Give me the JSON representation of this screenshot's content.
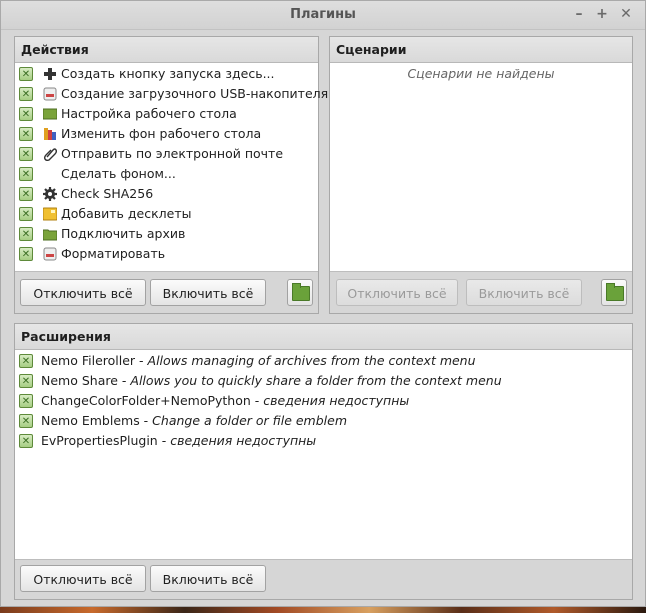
{
  "window": {
    "title": "Плагины"
  },
  "actions": {
    "header": "Действия",
    "items": [
      {
        "label": "Создать кнопку запуска здесь...",
        "icon": "plus-icon"
      },
      {
        "label": "Создание загрузочного USB-накопителя",
        "icon": "usb-drive-icon"
      },
      {
        "label": "Настройка рабочего стола",
        "icon": "desktop-settings-icon"
      },
      {
        "label": "Изменить фон рабочего стола",
        "icon": "wallpaper-icon"
      },
      {
        "label": "Отправить по электронной почте",
        "icon": "paperclip-icon"
      },
      {
        "label": "Сделать фоном...",
        "icon": ""
      },
      {
        "label": "Check SHA256",
        "icon": "gear-icon"
      },
      {
        "label": "Добавить десклеты",
        "icon": "desklet-icon"
      },
      {
        "label": "Подключить архив",
        "icon": "folder-icon"
      },
      {
        "label": "Форматировать",
        "icon": "usb-drive-icon"
      }
    ],
    "disable_all": "Отключить всё",
    "enable_all": "Включить всё"
  },
  "scripts": {
    "header": "Сценарии",
    "empty": "Сценарии не найдены",
    "disable_all": "Отключить всё",
    "enable_all": "Включить всё"
  },
  "extensions": {
    "header": "Расширения",
    "items": [
      {
        "name": "Nemo Fileroller",
        "sep": " - ",
        "desc": "Allows managing of archives from the context menu"
      },
      {
        "name": "Nemo Share",
        "sep": " - ",
        "desc": "Allows you to quickly share a folder from the context menu"
      },
      {
        "name": "ChangeColorFolder+NemoPython",
        "sep": " - ",
        "desc": "сведения недоступны"
      },
      {
        "name": "Nemo Emblems",
        "sep": " - ",
        "desc": "Change a folder or file emblem"
      },
      {
        "name": "EvPropertiesPlugin",
        "sep": " - ",
        "desc": "сведения недоступны"
      }
    ],
    "disable_all": "Отключить всё",
    "enable_all": "Включить всё"
  }
}
